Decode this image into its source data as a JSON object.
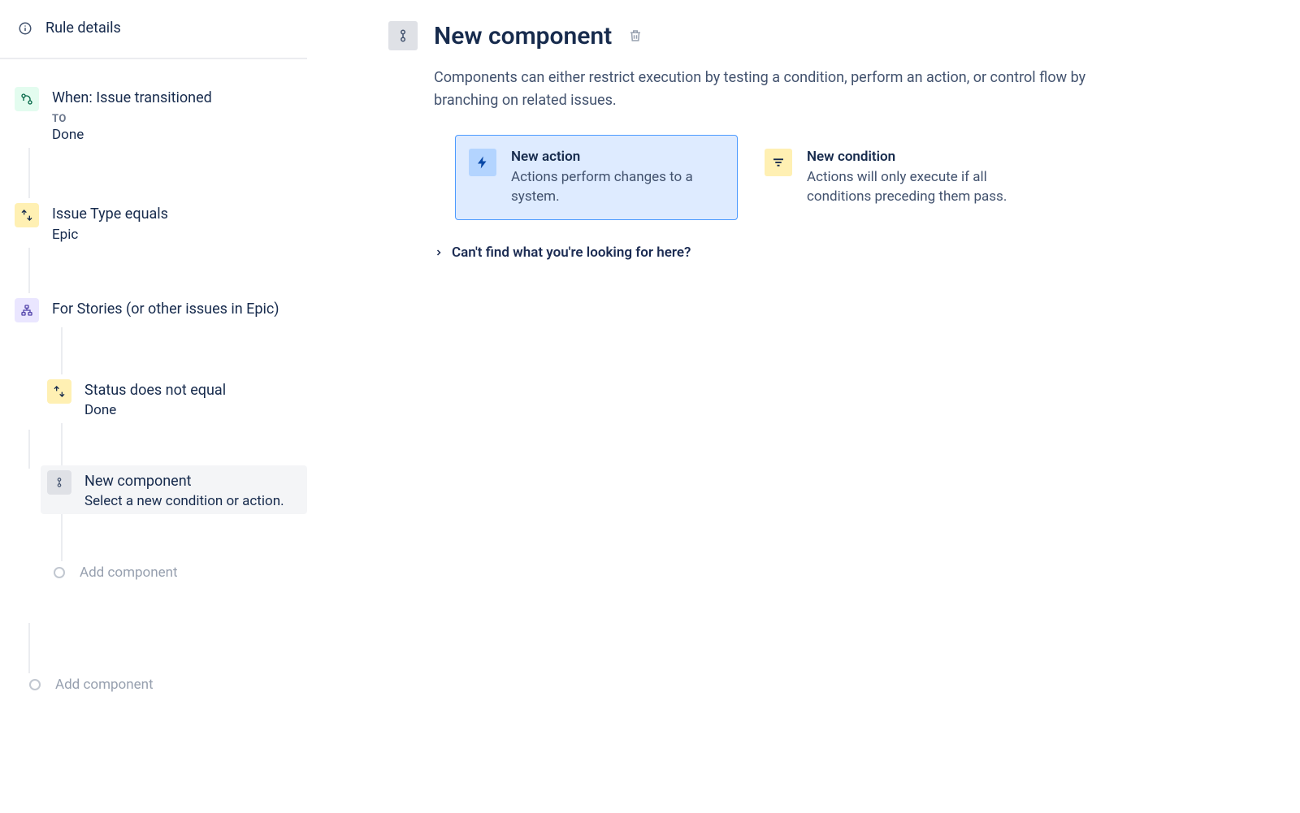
{
  "sidebar": {
    "rule_details": "Rule details",
    "trigger": {
      "title": "When: Issue transitioned",
      "sub_label": "TO",
      "sub_value": "Done"
    },
    "cond1": {
      "title": "Issue Type equals",
      "sub_value": "Epic"
    },
    "branch_header": "For Stories (or other issues in Epic)",
    "branch_cond": {
      "title": "Status does not equal",
      "sub_value": "Done"
    },
    "new_component": {
      "title": "New component",
      "sub_value": "Select a new condition or action."
    },
    "add_component": "Add component"
  },
  "main": {
    "title": "New component",
    "description": "Components can either restrict execution by testing a condition, perform an action, or control flow by branching on related issues.",
    "cards": {
      "action": {
        "title": "New action",
        "desc": "Actions perform changes to a system."
      },
      "condition": {
        "title": "New condition",
        "desc": "Actions will only execute if all conditions preceding them pass."
      }
    },
    "cant_find": "Can't find what you're looking for here?"
  }
}
